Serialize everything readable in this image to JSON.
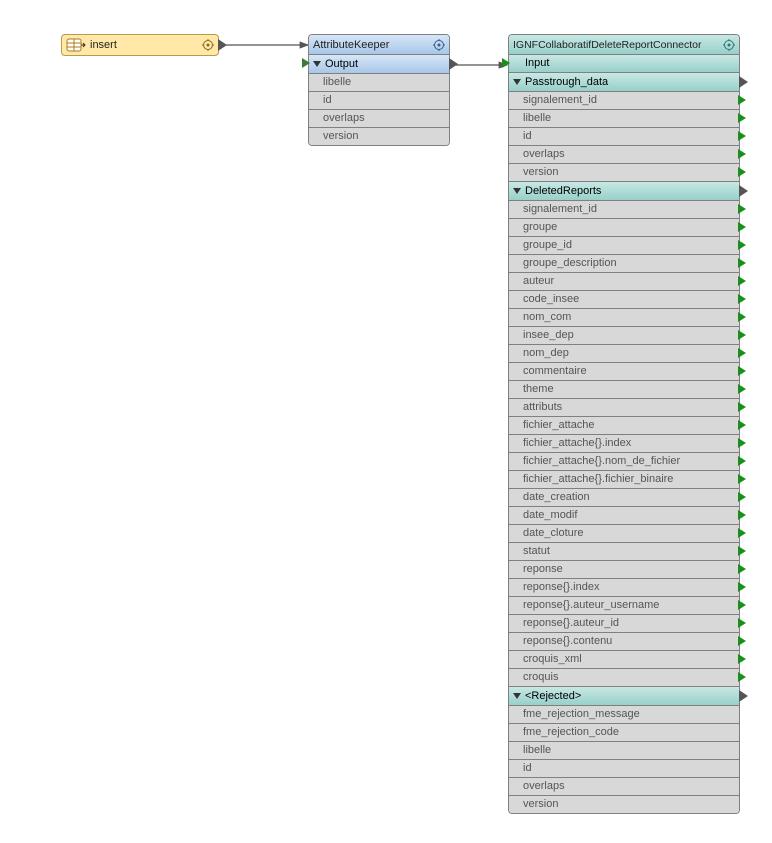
{
  "reader": {
    "label": "insert"
  },
  "attributeKeeper": {
    "title": "AttributeKeeper",
    "output_label": "Output",
    "attrs": [
      "libelle",
      "id",
      "overlaps",
      "version"
    ]
  },
  "connector": {
    "title": "IGNFCollaboratifDeleteReportConnector",
    "input_label": "Input",
    "sections": [
      {
        "label": "Passtrough_data",
        "attrs": [
          "signalement_id",
          "libelle",
          "id",
          "overlaps",
          "version"
        ]
      },
      {
        "label": "DeletedReports",
        "attrs": [
          "signalement_id",
          "groupe",
          "groupe_id",
          "groupe_description",
          "auteur",
          "code_insee",
          "nom_com",
          "insee_dep",
          "nom_dep",
          "commentaire",
          "theme",
          "attributs",
          "fichier_attache",
          "fichier_attache{}.index",
          "fichier_attache{}.nom_de_fichier",
          "fichier_attache{}.fichier_binaire",
          "date_creation",
          "date_modif",
          "date_cloture",
          "statut",
          "reponse",
          "reponse{}.index",
          "reponse{}.auteur_username",
          "reponse{}.auteur_id",
          "reponse{}.contenu",
          "croquis_xml",
          "croquis"
        ]
      },
      {
        "label": "<Rejected>",
        "attrs": [
          "fme_rejection_message",
          "fme_rejection_code",
          "libelle",
          "id",
          "overlaps",
          "version"
        ],
        "no_markers": true
      }
    ]
  }
}
